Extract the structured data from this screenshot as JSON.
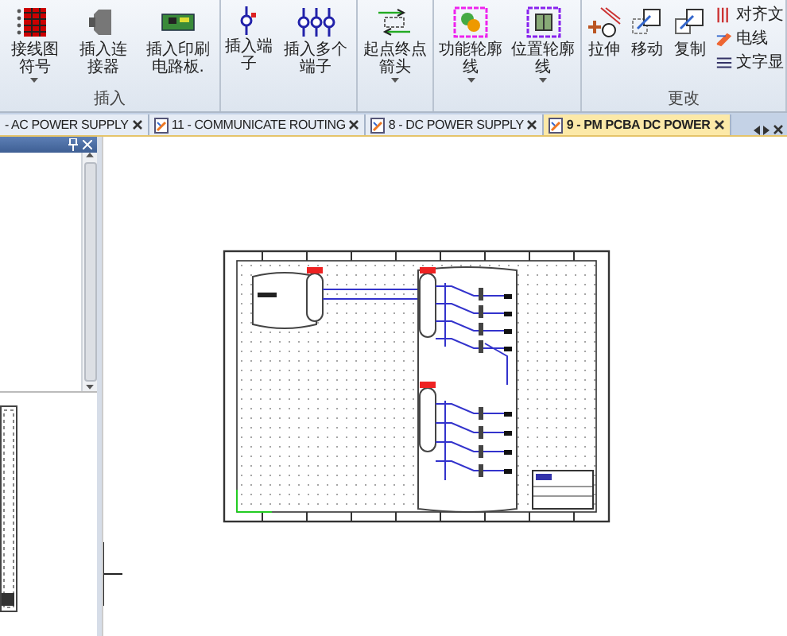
{
  "ribbon": {
    "groups": [
      {
        "label": "插入",
        "buttons": [
          {
            "label": "接线图符号",
            "dropdown": true
          },
          {
            "label": "插入连接器",
            "dropdown": false
          },
          {
            "label": "插入印刷电路板.",
            "dropdown": false
          }
        ]
      },
      {
        "buttons": [
          {
            "label": "插入端子",
            "dropdown": false
          },
          {
            "label": "插入多个端子",
            "dropdown": false
          }
        ]
      },
      {
        "buttons": [
          {
            "label": "起点终点箭头",
            "dropdown": true
          }
        ]
      },
      {
        "buttons": [
          {
            "label": "功能轮廓线",
            "dropdown": true
          },
          {
            "label": "位置轮廓线",
            "dropdown": true
          }
        ]
      },
      {
        "label": "更改",
        "buttons": [
          {
            "label": "拉伸",
            "dropdown": false
          },
          {
            "label": "移动",
            "dropdown": false
          },
          {
            "label": "复制",
            "dropdown": false
          }
        ],
        "small_buttons": [
          "对齐文",
          "电线",
          "文字显"
        ]
      }
    ]
  },
  "tabs": [
    {
      "label": "- AC POWER SUPPLY",
      "icon": false,
      "selected": false
    },
    {
      "label": "11 - COMMUNICATE ROUTING",
      "icon": true,
      "selected": false
    },
    {
      "label": "8 - DC POWER SUPPLY",
      "icon": true,
      "selected": false
    },
    {
      "label": "9 - PM PCBA DC POWER",
      "icon": true,
      "selected": true
    }
  ]
}
